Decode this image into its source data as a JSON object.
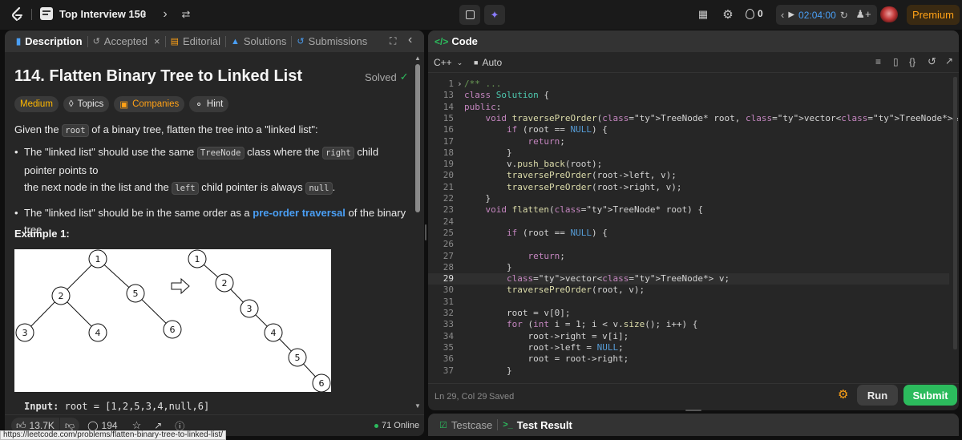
{
  "topbar": {
    "problem_list": "Top Interview 150",
    "streak_count": "0",
    "timer": "02:04:00",
    "premium": "Premium"
  },
  "left_tabs": [
    {
      "label": "Description"
    },
    {
      "label": "Accepted"
    },
    {
      "label": "Editorial"
    },
    {
      "label": "Solutions"
    },
    {
      "label": "Submissions"
    }
  ],
  "problem": {
    "title": "114. Flatten Binary Tree to Linked List",
    "status": "Solved",
    "difficulty": "Medium",
    "tags": [
      "Topics",
      "Companies",
      "Hint"
    ],
    "desc": {
      "p1_a": "Given the",
      "p1_code": "root",
      "p1_b": "of a binary tree, flatten the tree into a \"linked list\":",
      "b1_a": "The \"linked list\" should use the same",
      "b1_code1": "TreeNode",
      "b1_b": "class where the",
      "b1_code2": "right",
      "b1_c": "child pointer points to",
      "b1_d": "the next node in the list and the",
      "b1_code3": "left",
      "b1_e": "child pointer is always",
      "b1_code4": "null",
      "b1_f": ".",
      "b2_a": "The \"linked list\" should be in the same order as a",
      "b2_link": "pre-order traversal",
      "b2_b": "of the binary tree."
    },
    "example_title": "Example 1:",
    "example_input_label": "Input:",
    "example_input_value": "root = [1,2,5,3,4,null,6]",
    "tree_nodes": [
      "1",
      "2",
      "5",
      "3",
      "4",
      "6"
    ],
    "list_nodes": [
      "1",
      "2",
      "3",
      "4",
      "5",
      "6"
    ]
  },
  "left_footer": {
    "likes": "13.7K",
    "comments": "194",
    "online": "71 Online"
  },
  "code_panel": {
    "title": "Code",
    "language": "C++",
    "mode": "Auto",
    "status_pos": "Ln 29, Col 29",
    "status_saved": "Saved",
    "run": "Run",
    "submit": "Submit"
  },
  "code_lines": [
    {
      "n": "1",
      "t": "/** ..."
    },
    {
      "n": "13",
      "t": "class Solution {"
    },
    {
      "n": "14",
      "t": "public:"
    },
    {
      "n": "15",
      "t": "    void traversePreOrder(TreeNode* root, vector<TreeNode*>& v) {"
    },
    {
      "n": "16",
      "t": "        if (root == NULL) {"
    },
    {
      "n": "17",
      "t": "            return;"
    },
    {
      "n": "18",
      "t": "        }"
    },
    {
      "n": "19",
      "t": "        v.push_back(root);"
    },
    {
      "n": "20",
      "t": "        traversePreOrder(root->left, v);"
    },
    {
      "n": "21",
      "t": "        traversePreOrder(root->right, v);"
    },
    {
      "n": "22",
      "t": "    }"
    },
    {
      "n": "23",
      "t": "    void flatten(TreeNode* root) {"
    },
    {
      "n": "24",
      "t": ""
    },
    {
      "n": "25",
      "t": "        if (root == NULL) {"
    },
    {
      "n": "26",
      "t": ""
    },
    {
      "n": "27",
      "t": "            return;"
    },
    {
      "n": "28",
      "t": "        }"
    },
    {
      "n": "29",
      "t": "        vector<TreeNode*> v;"
    },
    {
      "n": "30",
      "t": "        traversePreOrder(root, v);"
    },
    {
      "n": "31",
      "t": ""
    },
    {
      "n": "32",
      "t": "        root = v[0];"
    },
    {
      "n": "33",
      "t": "        for (int i = 1; i < v.size(); i++) {"
    },
    {
      "n": "34",
      "t": "            root->right = v[i];"
    },
    {
      "n": "35",
      "t": "            root->left = NULL;"
    },
    {
      "n": "36",
      "t": "            root = root->right;"
    },
    {
      "n": "37",
      "t": "        }"
    }
  ],
  "test_tabs": [
    {
      "label": "Testcase"
    },
    {
      "label": "Test Result"
    }
  ],
  "status_url": "https://leetcode.com/problems/flatten-binary-tree-to-linked-list/"
}
